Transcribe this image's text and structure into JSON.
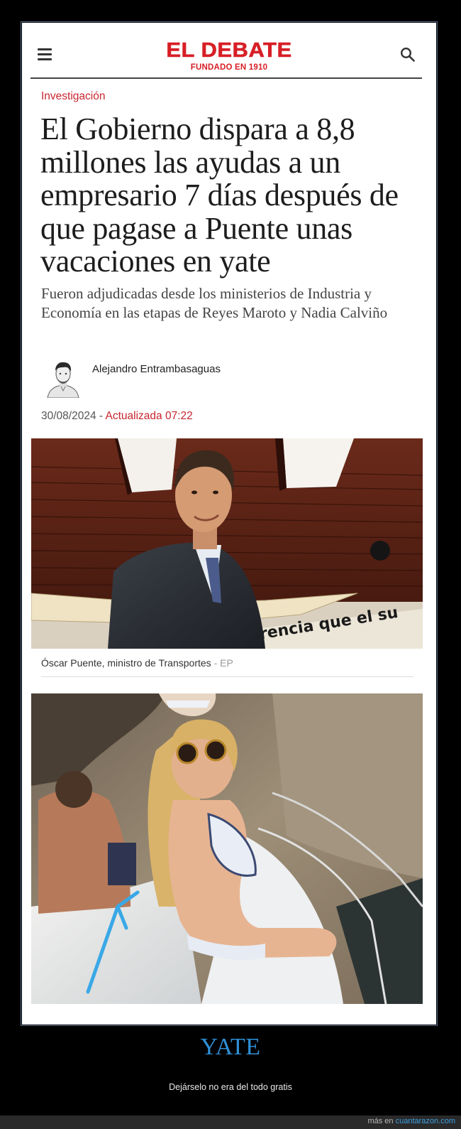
{
  "site": {
    "logo": "EL DEBATE",
    "tagline": "FUNDADO EN 1910",
    "brand_color": "#d71f26",
    "icons": {
      "menu": "hamburger-menu-icon",
      "search": "search-icon"
    }
  },
  "article": {
    "section": "Investigación",
    "headline": "El Gobierno dispara a 8,8 millones las ayudas a un empresario 7 días después de que pagase a Puente unas vacaciones en yate",
    "subheadline": "Fueron adjudicadas desde los ministerios de Industria y Economía en las etapas de Reyes Maroto y Nadia Calviño",
    "author": "Alejandro Entrambasaguas",
    "date": "30/08/2024",
    "separator": "-",
    "updated": "Actualizada 07:22",
    "photo1_caption": "Óscar Puente, ministro de Transportes",
    "photo1_credit": "- EP"
  },
  "meme": {
    "title": "YATE",
    "subtitle": "Dejárselo no era del todo gratis",
    "footer_prefix": "más en",
    "footer_site": "cuantarazon.com",
    "accent_color": "#2f8fd6"
  }
}
